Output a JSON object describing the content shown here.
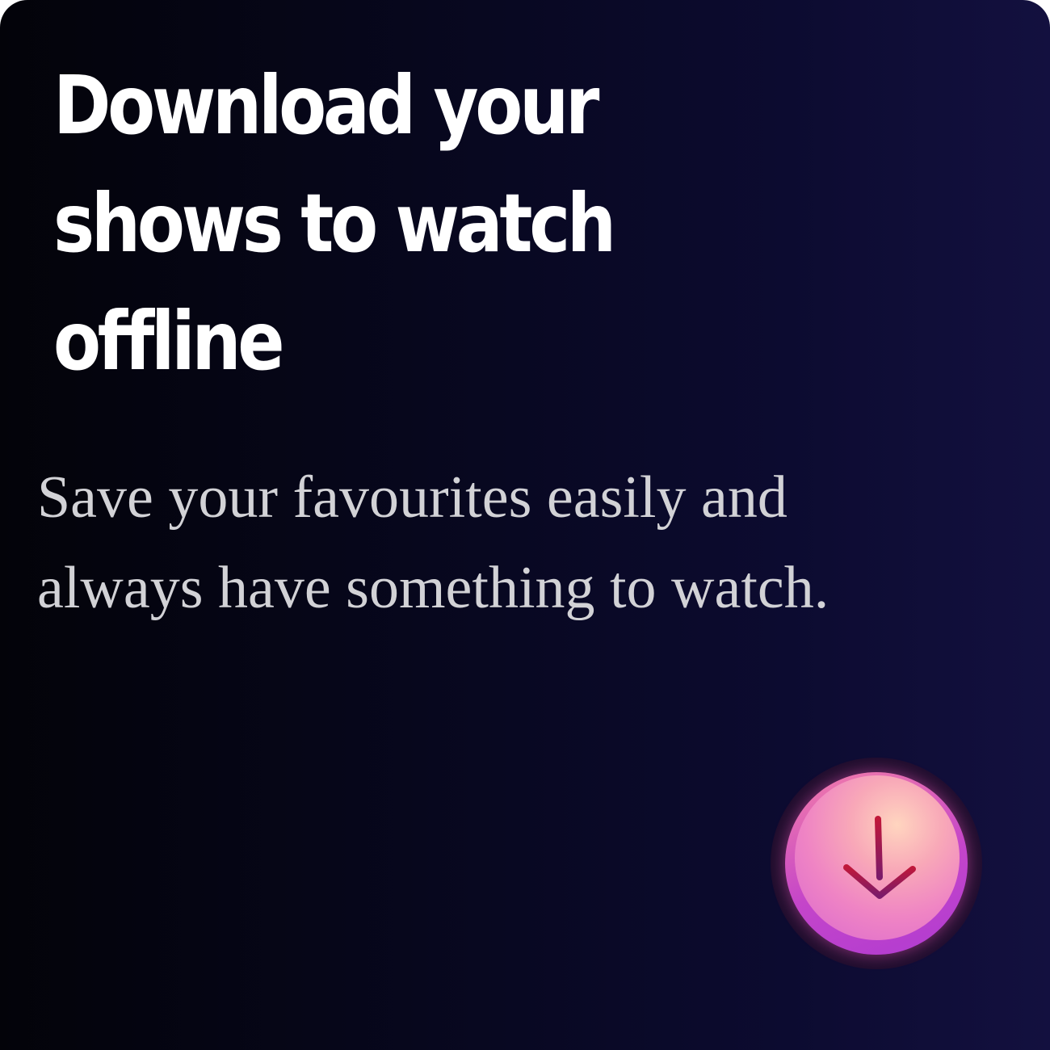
{
  "promo": {
    "title_lines": [
      "Download your",
      "shows to watch",
      "offline"
    ],
    "subtitle_lines": [
      "Save your favourites easily and",
      "always have something to watch."
    ]
  },
  "download_button": {
    "icon": "arrow-down-icon"
  },
  "colors": {
    "background_start": "#030309",
    "background_end": "#13103f",
    "title": "#ffffff",
    "subtitle": "#d2d2d6",
    "button_pink": "#f8a8b8",
    "button_purple": "#c445c9",
    "arrow": "#8a1a55"
  }
}
